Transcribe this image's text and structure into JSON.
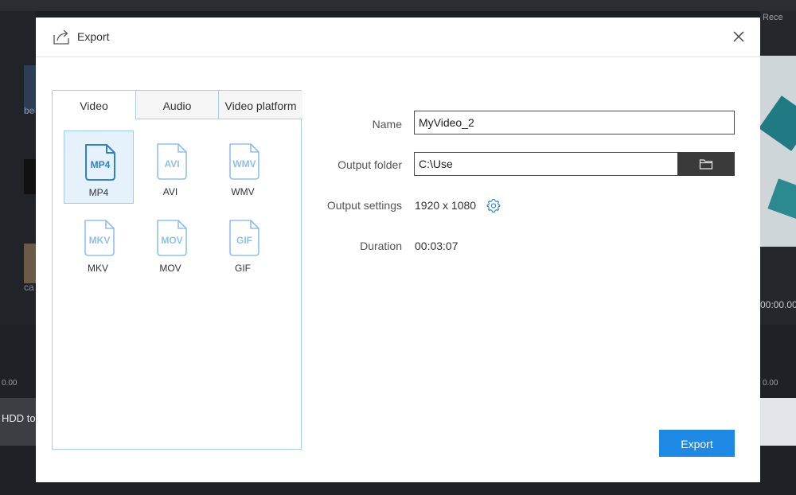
{
  "background_app": {
    "left_labels": [
      "be",
      "ca"
    ],
    "rec_label": "Rece",
    "time_readout": "00:00.00",
    "ruler_left": "0.00",
    "ruler_right": "0.00",
    "track_label": "HDD to"
  },
  "dialog": {
    "title": "Export",
    "tabs": [
      {
        "label": "Video",
        "active": true
      },
      {
        "label": "Audio",
        "active": false
      },
      {
        "label": "Video platform",
        "active": false
      }
    ],
    "formats": [
      {
        "id": "mp4",
        "icon_text": "MP4",
        "label": "MP4",
        "selected": true
      },
      {
        "id": "avi",
        "icon_text": "AVI",
        "label": "AVI",
        "selected": false
      },
      {
        "id": "wmv",
        "icon_text": "WMV",
        "label": "WMV",
        "selected": false
      },
      {
        "id": "mkv",
        "icon_text": "MKV",
        "label": "MKV",
        "selected": false
      },
      {
        "id": "mov",
        "icon_text": "MOV",
        "label": "MOV",
        "selected": false
      },
      {
        "id": "gif",
        "icon_text": "GIF",
        "label": "GIF",
        "selected": false
      }
    ],
    "form": {
      "name_label": "Name",
      "name_value": "MyVideo_2",
      "folder_label": "Output folder",
      "folder_value": "C:\\Use",
      "settings_label": "Output settings",
      "settings_value": "1920 x 1080",
      "duration_label": "Duration",
      "duration_value": "00:03:07"
    },
    "export_button": "Export",
    "colors": {
      "accent": "#1e88e5",
      "selected_bg": "#e5f1fb",
      "border": "#a9cdee",
      "icon_selected": "#2f7fd1",
      "icon_unselected": "#8fc0ec"
    }
  }
}
